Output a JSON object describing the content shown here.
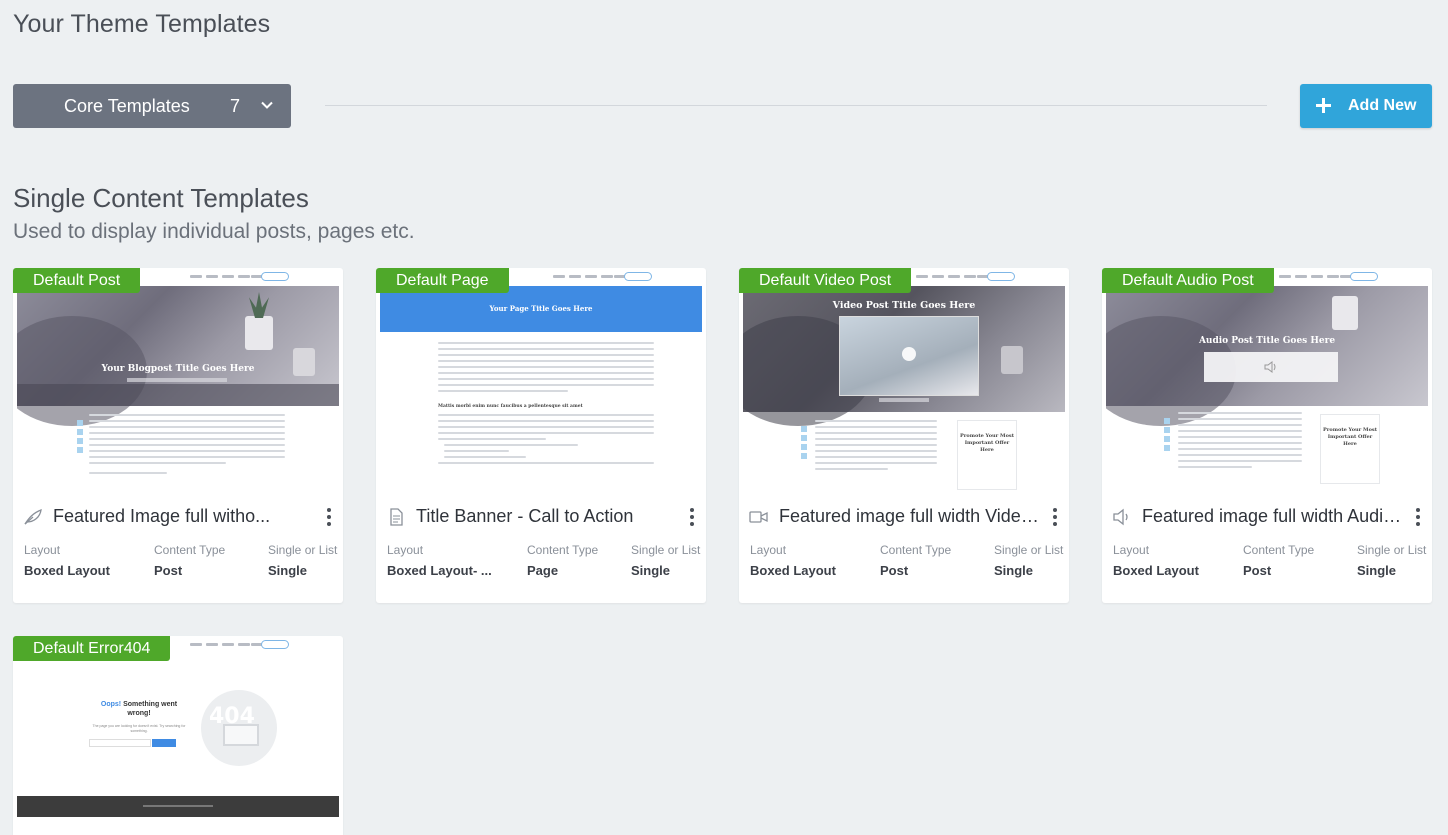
{
  "page": {
    "title": "Your Theme Templates"
  },
  "toolbar": {
    "dropdown_label": "Core Templates",
    "dropdown_count": "7",
    "add_new_label": "Add New",
    "accent_color": "#30a5da"
  },
  "section": {
    "title": "Single Content Templates",
    "subtitle": "Used to display individual posts, pages etc."
  },
  "meta_labels": {
    "layout": "Layout",
    "content_type": "Content Type",
    "single_or_list": "Single or List"
  },
  "badge_color": "#4fa82a",
  "cards": [
    {
      "badge": "Default Post",
      "title": "Featured Image full witho...",
      "icon": "feather-icon",
      "layout": "Boxed Layout",
      "content_type": "Post",
      "single_or_list": "Single"
    },
    {
      "badge": "Default Page",
      "title": "Title Banner - Call to Action",
      "icon": "document-icon",
      "layout": "Boxed Layout- ...",
      "content_type": "Page",
      "single_or_list": "Single"
    },
    {
      "badge": "Default Video Post",
      "title": "Featured image full width Video...",
      "icon": "video-icon",
      "layout": "Boxed Layout",
      "content_type": "Post",
      "single_or_list": "Single"
    },
    {
      "badge": "Default Audio Post",
      "title": "Featured image full width Audio...",
      "icon": "speaker-icon",
      "layout": "Boxed Layout",
      "content_type": "Post",
      "single_or_list": "Single"
    },
    {
      "badge": "Default Error404"
    }
  ],
  "thumbnails": {
    "post_hero_title": "Your Blogpost Title Goes Here",
    "page_banner_title": "Your Page Title Goes Here",
    "page_subheading": "Mattis morbi enim nunc faucibus a pellentesque sit amet",
    "video_hero_title": "Video Post Title Goes Here",
    "audio_hero_title": "Audio Post Title Goes Here",
    "widget_title": "Promote Your Most Important Offer Here",
    "error_title_blue": "Oops!",
    "error_title_rest": "Something went wrong!",
    "error_sub": "The page you are looking for doesn't exist. Try searching for something.",
    "error_bg_text": "404"
  }
}
